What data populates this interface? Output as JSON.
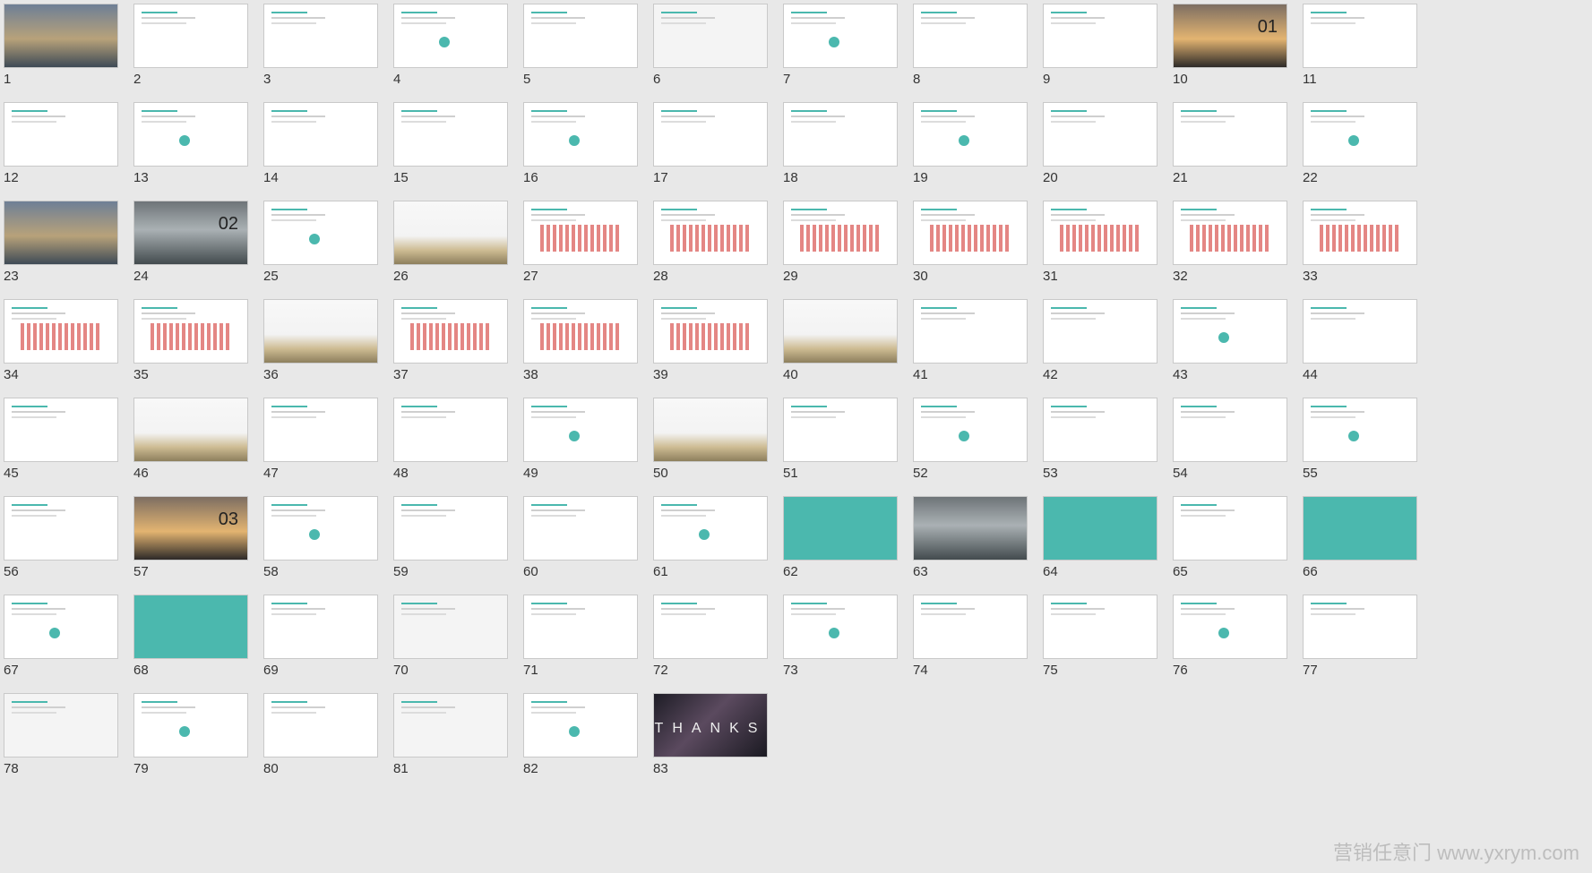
{
  "grid": {
    "slides": [
      {
        "n": "1",
        "style": "photo"
      },
      {
        "n": "2",
        "style": "plain"
      },
      {
        "n": "3",
        "style": "plain"
      },
      {
        "n": "4",
        "style": "plain"
      },
      {
        "n": "5",
        "style": "plain"
      },
      {
        "n": "6",
        "style": "gray"
      },
      {
        "n": "7",
        "style": "plain"
      },
      {
        "n": "8",
        "style": "plain"
      },
      {
        "n": "9",
        "style": "plain"
      },
      {
        "n": "10",
        "style": "sunset",
        "big": "01"
      },
      {
        "n": "11",
        "style": "plain"
      },
      {
        "n": "12",
        "style": "plain"
      },
      {
        "n": "13",
        "style": "plain"
      },
      {
        "n": "14",
        "style": "plain"
      },
      {
        "n": "15",
        "style": "plain"
      },
      {
        "n": "16",
        "style": "plain"
      },
      {
        "n": "17",
        "style": "plain"
      },
      {
        "n": "18",
        "style": "plain"
      },
      {
        "n": "19",
        "style": "plain"
      },
      {
        "n": "20",
        "style": "plain"
      },
      {
        "n": "21",
        "style": "plain"
      },
      {
        "n": "22",
        "style": "plain"
      },
      {
        "n": "23",
        "style": "photo"
      },
      {
        "n": "24",
        "style": "mountain",
        "big": "02"
      },
      {
        "n": "25",
        "style": "plain"
      },
      {
        "n": "26",
        "style": "beige"
      },
      {
        "n": "27",
        "style": "chart"
      },
      {
        "n": "28",
        "style": "chart"
      },
      {
        "n": "29",
        "style": "chart"
      },
      {
        "n": "30",
        "style": "chart"
      },
      {
        "n": "31",
        "style": "chart"
      },
      {
        "n": "32",
        "style": "chart"
      },
      {
        "n": "33",
        "style": "chart"
      },
      {
        "n": "34",
        "style": "chart"
      },
      {
        "n": "35",
        "style": "chart"
      },
      {
        "n": "36",
        "style": "beige"
      },
      {
        "n": "37",
        "style": "chart"
      },
      {
        "n": "38",
        "style": "chart"
      },
      {
        "n": "39",
        "style": "chart"
      },
      {
        "n": "40",
        "style": "beige"
      },
      {
        "n": "41",
        "style": "plain"
      },
      {
        "n": "42",
        "style": "plain"
      },
      {
        "n": "43",
        "style": "plain"
      },
      {
        "n": "44",
        "style": "plain"
      },
      {
        "n": "45",
        "style": "plain"
      },
      {
        "n": "46",
        "style": "beige"
      },
      {
        "n": "47",
        "style": "plain"
      },
      {
        "n": "48",
        "style": "plain"
      },
      {
        "n": "49",
        "style": "plain"
      },
      {
        "n": "50",
        "style": "beige"
      },
      {
        "n": "51",
        "style": "plain"
      },
      {
        "n": "52",
        "style": "plain"
      },
      {
        "n": "53",
        "style": "plain"
      },
      {
        "n": "54",
        "style": "plain"
      },
      {
        "n": "55",
        "style": "plain"
      },
      {
        "n": "56",
        "style": "plain"
      },
      {
        "n": "57",
        "style": "sunset",
        "big": "03"
      },
      {
        "n": "58",
        "style": "plain"
      },
      {
        "n": "59",
        "style": "plain"
      },
      {
        "n": "60",
        "style": "plain"
      },
      {
        "n": "61",
        "style": "plain"
      },
      {
        "n": "62",
        "style": "teal"
      },
      {
        "n": "63",
        "style": "mountain"
      },
      {
        "n": "64",
        "style": "teal"
      },
      {
        "n": "65",
        "style": "plain"
      },
      {
        "n": "66",
        "style": "teal"
      },
      {
        "n": "67",
        "style": "plain"
      },
      {
        "n": "68",
        "style": "teal"
      },
      {
        "n": "69",
        "style": "plain"
      },
      {
        "n": "70",
        "style": "gray"
      },
      {
        "n": "71",
        "style": "plain"
      },
      {
        "n": "72",
        "style": "plain"
      },
      {
        "n": "73",
        "style": "plain"
      },
      {
        "n": "74",
        "style": "plain"
      },
      {
        "n": "75",
        "style": "plain"
      },
      {
        "n": "76",
        "style": "plain"
      },
      {
        "n": "77",
        "style": "plain"
      },
      {
        "n": "78",
        "style": "gray"
      },
      {
        "n": "79",
        "style": "plain"
      },
      {
        "n": "80",
        "style": "plain"
      },
      {
        "n": "81",
        "style": "gray"
      },
      {
        "n": "82",
        "style": "plain"
      },
      {
        "n": "83",
        "style": "thanks",
        "thanks": "THANKS"
      }
    ]
  },
  "watermark": "营销任意门 www.yxrym.com",
  "colors": {
    "accent": "#4bb8ae",
    "background": "#e8e8e8"
  }
}
